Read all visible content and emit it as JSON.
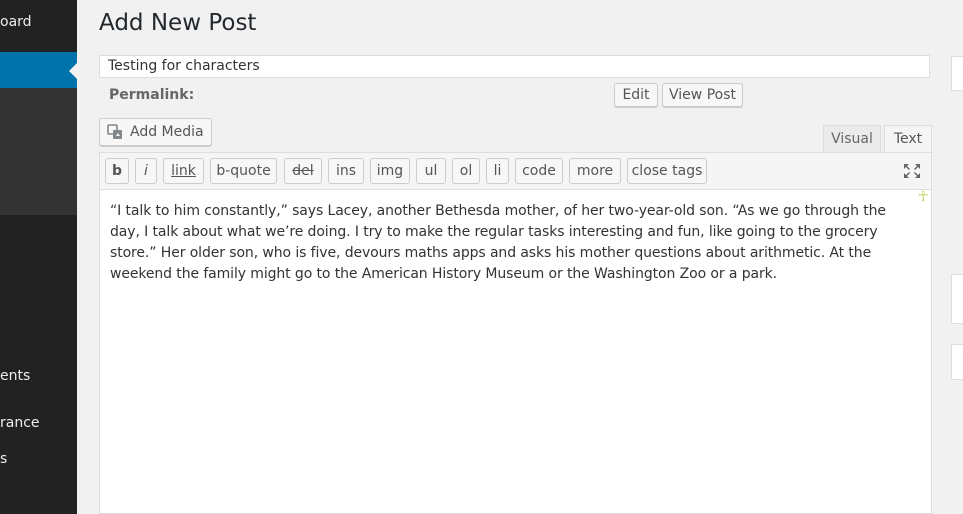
{
  "sidebar": {
    "items": [
      {
        "label": "oard"
      },
      {
        "label": "ents"
      },
      {
        "label": "rance"
      },
      {
        "label": "s"
      }
    ]
  },
  "page": {
    "title": "Add New Post"
  },
  "post": {
    "title_value": "Testing for characters",
    "permalink_label": "Permalink:",
    "edit_label": "Edit",
    "view_label": "View Post"
  },
  "media": {
    "add_label": "Add Media"
  },
  "tabs": {
    "visual": "Visual",
    "text": "Text"
  },
  "toolbar": {
    "buttons": [
      "b",
      "i",
      "link",
      "b-quote",
      "del",
      "ins",
      "img",
      "ul",
      "ol",
      "li",
      "code",
      "more",
      "close tags"
    ]
  },
  "editor": {
    "content": "“I talk to him constantly,” says Lacey, another Bethesda mother, of her two-year-old son. “As we go through the day, I talk about what we’re doing. I try to make the regular tasks interesting and fun, like going to the grocery store.” Her older son, who is five, devours maths apps and asks his mother questions about arithmetic. At the weekend the family might go to the American History Museum or the Washington Zoo or a park."
  }
}
